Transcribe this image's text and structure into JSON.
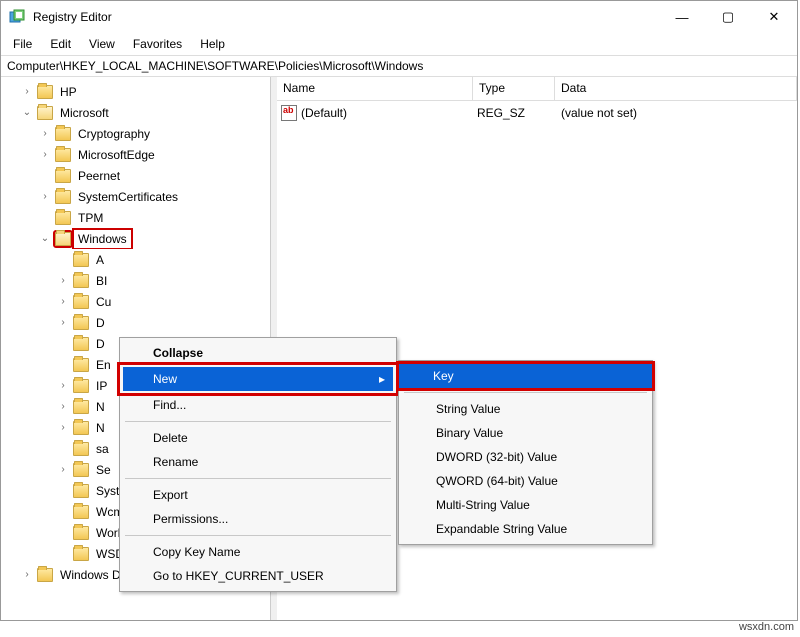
{
  "window": {
    "title": "Registry Editor"
  },
  "controls": {
    "min": "—",
    "max": "▢",
    "close": "✕"
  },
  "menubar": [
    "File",
    "Edit",
    "View",
    "Favorites",
    "Help"
  ],
  "address": "Computer\\HKEY_LOCAL_MACHINE\\SOFTWARE\\Policies\\Microsoft\\Windows",
  "list": {
    "cols": {
      "name": "Name",
      "type": "Type",
      "data": "Data"
    },
    "rows": [
      {
        "name": "(Default)",
        "type": "REG_SZ",
        "data": "(value not set)"
      }
    ]
  },
  "tree": [
    {
      "d": 1,
      "exp": ">",
      "open": false,
      "label": "HP"
    },
    {
      "d": 1,
      "exp": "v",
      "open": true,
      "label": "Microsoft"
    },
    {
      "d": 2,
      "exp": ">",
      "open": false,
      "label": "Cryptography"
    },
    {
      "d": 2,
      "exp": ">",
      "open": false,
      "label": "MicrosoftEdge"
    },
    {
      "d": 2,
      "exp": " ",
      "open": false,
      "label": "Peernet"
    },
    {
      "d": 2,
      "exp": ">",
      "open": false,
      "label": "SystemCertificates"
    },
    {
      "d": 2,
      "exp": " ",
      "open": false,
      "label": "TPM"
    },
    {
      "d": 2,
      "exp": "v",
      "open": true,
      "label": "Windows",
      "sel": true
    },
    {
      "d": 3,
      "exp": " ",
      "open": false,
      "label": "A"
    },
    {
      "d": 3,
      "exp": ">",
      "open": false,
      "label": "BI"
    },
    {
      "d": 3,
      "exp": ">",
      "open": false,
      "label": "Cu"
    },
    {
      "d": 3,
      "exp": ">",
      "open": false,
      "label": "D"
    },
    {
      "d": 3,
      "exp": " ",
      "open": false,
      "label": "D"
    },
    {
      "d": 3,
      "exp": " ",
      "open": false,
      "label": "En"
    },
    {
      "d": 3,
      "exp": ">",
      "open": false,
      "label": "IP"
    },
    {
      "d": 3,
      "exp": ">",
      "open": false,
      "label": "N"
    },
    {
      "d": 3,
      "exp": ">",
      "open": false,
      "label": "N"
    },
    {
      "d": 3,
      "exp": " ",
      "open": false,
      "label": "sa"
    },
    {
      "d": 3,
      "exp": ">",
      "open": false,
      "label": "Se"
    },
    {
      "d": 3,
      "exp": " ",
      "open": false,
      "label": "System"
    },
    {
      "d": 3,
      "exp": " ",
      "open": false,
      "label": "WcmSvc"
    },
    {
      "d": 3,
      "exp": " ",
      "open": false,
      "label": "WorkplaceJoin"
    },
    {
      "d": 3,
      "exp": " ",
      "open": false,
      "label": "WSDAPI"
    },
    {
      "d": 1,
      "exp": ">",
      "open": false,
      "label": "Windows Defender"
    }
  ],
  "ctx1": {
    "collapse": "Collapse",
    "new": "New",
    "find": "Find...",
    "delete": "Delete",
    "rename": "Rename",
    "export": "Export",
    "perm": "Permissions...",
    "copykey": "Copy Key Name",
    "goto": "Go to HKEY_CURRENT_USER"
  },
  "ctx2": {
    "key": "Key",
    "string": "String Value",
    "binary": "Binary Value",
    "dword": "DWORD (32-bit) Value",
    "qword": "QWORD (64-bit) Value",
    "multi": "Multi-String Value",
    "exp": "Expandable String Value"
  },
  "watermark": "wsxdn.com"
}
